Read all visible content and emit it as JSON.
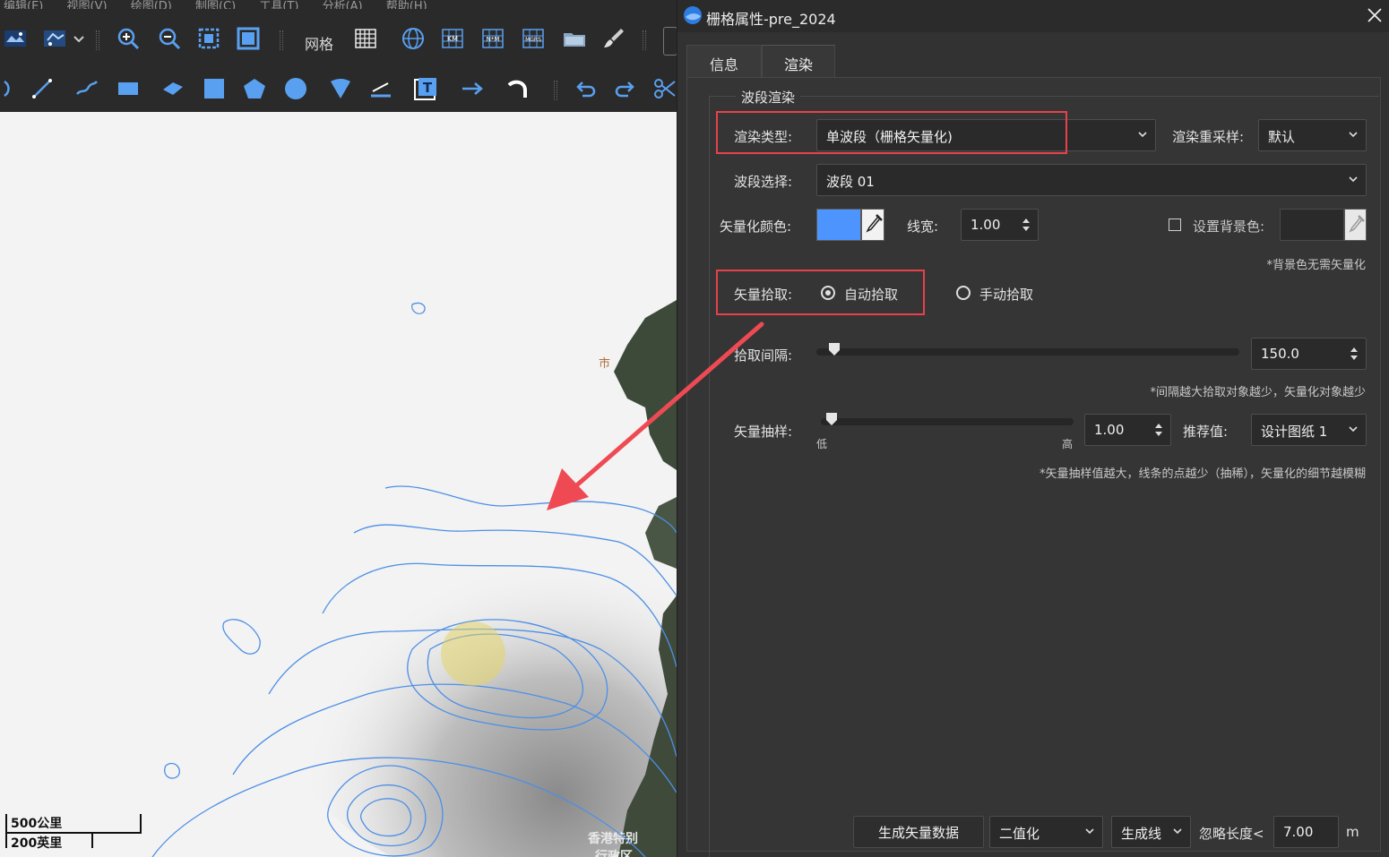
{
  "menubar": [
    "编辑(E)",
    "视图(V)",
    "绘图(D)",
    "制图(C)",
    "工具(T)",
    "分析(A)",
    "帮助(H)"
  ],
  "toolbar": {
    "grid_label": "网格"
  },
  "map": {
    "scale_km": "500公里",
    "scale_mi": "200英里",
    "label_city": "市",
    "label_hk_1": "香港特别",
    "label_hk_2": "行政区"
  },
  "dialog": {
    "title": "栅格属性-pre_2024",
    "tabs": [
      "信息",
      "渲染"
    ],
    "group_title": "波段渲染",
    "render_type_label": "渲染类型:",
    "render_type_value": "单波段（栅格矢量化)",
    "resample_label": "渲染重采样:",
    "resample_value": "默认",
    "band_label": "波段选择:",
    "band_value": "波段 01",
    "vector_color_label": "矢量化颜色:",
    "vector_color": "#4d94ff",
    "line_width_label": "线宽:",
    "line_width_value": "1.00",
    "bg_color_label": "设置背景色:",
    "bg_note": "*背景色无需矢量化",
    "pick_label": "矢量拾取:",
    "pick_auto": "自动拾取",
    "pick_manual": "手动拾取",
    "interval_label": "拾取间隔:",
    "interval_value": "150.0",
    "interval_note": "*间隔越大拾取对象越少，矢量化对象越少",
    "sample_label": "矢量抽样:",
    "sample_low": "低",
    "sample_high": "高",
    "sample_value": "1.00",
    "recommend_label": "推荐值:",
    "recommend_value": "设计图纸 1",
    "sample_note": "*矢量抽样值越大，线条的点越少（抽稀），矢量化的细节越模糊",
    "generate_btn": "生成矢量数据",
    "mode_value": "二值化",
    "output_value": "生成线",
    "ignore_label": "忽略长度<",
    "ignore_value": "7.00",
    "ignore_unit": "m"
  },
  "colors": {
    "accent_red": "#e8414a",
    "contour_blue": "#4d8fe6",
    "dialog_bg": "#323232"
  },
  "slider": {
    "interval_fraction": 0.03,
    "sample_fraction": 0.02
  }
}
